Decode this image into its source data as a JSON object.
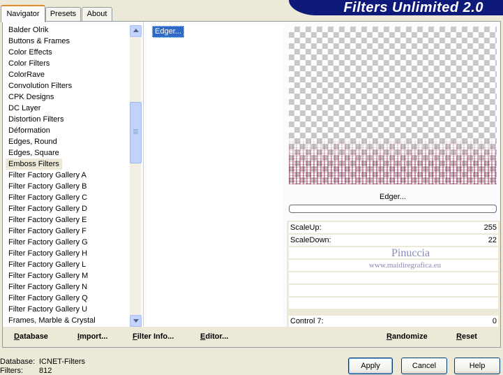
{
  "tabs": [
    "Navigator",
    "Presets",
    "About"
  ],
  "app_title": "Filters Unlimited 2.0",
  "categories": [
    "Balder Olrik",
    "Buttons & Frames",
    "Color Effects",
    "Color Filters",
    "ColorRave",
    "Convolution Filters",
    "CPK Designs",
    "DC Layer",
    "Distortion Filters",
    "Déformation",
    "Edges, Round",
    "Edges, Square",
    "Emboss Filters",
    "Filter Factory Gallery A",
    "Filter Factory Gallery B",
    "Filter Factory Gallery C",
    "Filter Factory Gallery D",
    "Filter Factory Gallery E",
    "Filter Factory Gallery F",
    "Filter Factory Gallery G",
    "Filter Factory Gallery H",
    "Filter Factory Gallery L",
    "Filter Factory Gallery M",
    "Filter Factory Gallery N",
    "Filter Factory Gallery Q",
    "Filter Factory Gallery U",
    "Frames, Marble & Crystal"
  ],
  "selected_category": "Emboss Filters",
  "filters": [
    "Edger..."
  ],
  "selected_filter_name": "Edger...",
  "progress": 0,
  "controls": [
    {
      "label": "ScaleUp:",
      "value": "255"
    },
    {
      "label": "ScaleDown:",
      "value": "22"
    }
  ],
  "control7": {
    "label": "Control 7:",
    "value": "0"
  },
  "watermark": {
    "line1": "Pinuccia",
    "line2": "www.maidiregrafica.eu"
  },
  "bottom_buttons": {
    "database": "Database",
    "import": "Import...",
    "filter_info": "Filter Info...",
    "editor": "Editor...",
    "randomize": "Randomize",
    "reset": "Reset"
  },
  "info": {
    "database_label": "Database:",
    "database_value": "ICNET-Filters",
    "filters_label": "Filters:",
    "filters_value": "812"
  },
  "dialog_buttons": {
    "apply": "Apply",
    "cancel": "Cancel",
    "help": "Help"
  },
  "colors": {
    "banner": "#0e1a7a",
    "selection": "#316ac5",
    "active_tab_accent": "#e68b2c"
  }
}
